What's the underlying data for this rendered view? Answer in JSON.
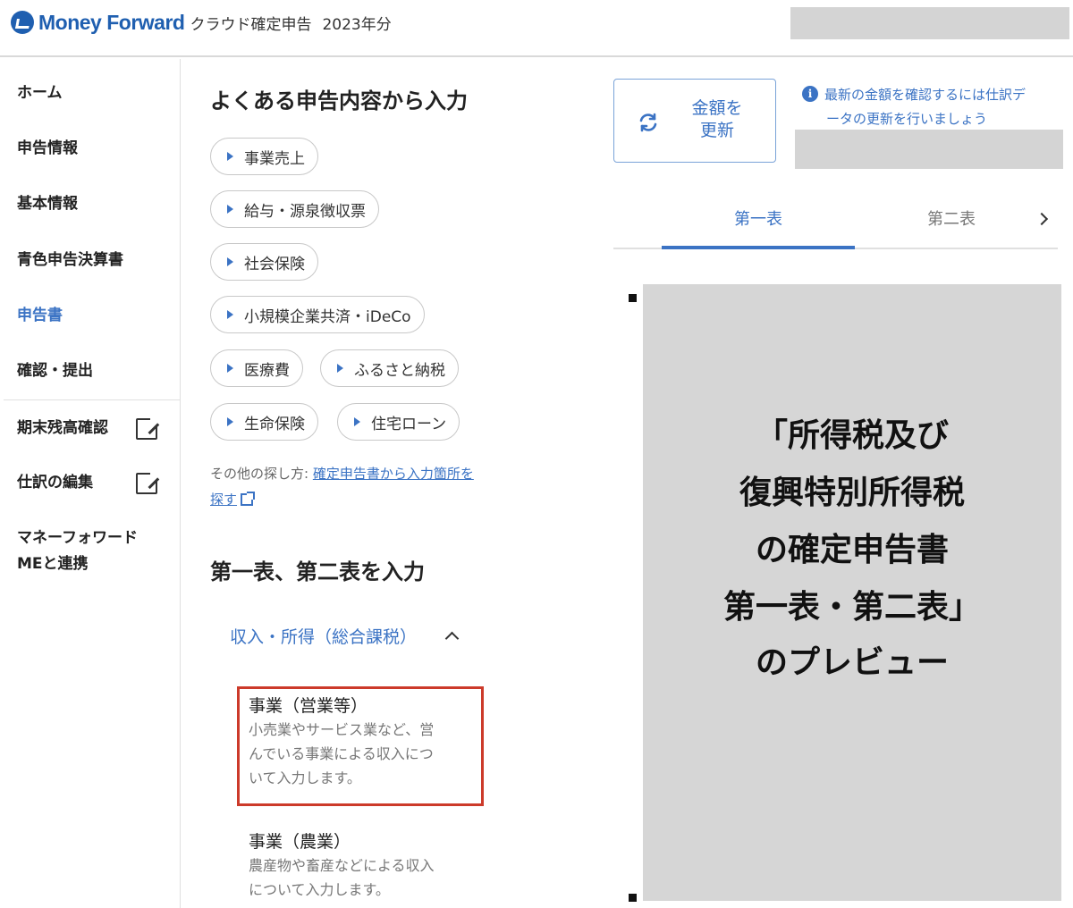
{
  "header": {
    "brand": "Money Forward",
    "product": "クラウド確定申告",
    "year": "2023年分"
  },
  "sidebar": {
    "items": [
      {
        "label": "ホーム"
      },
      {
        "label": "申告情報"
      },
      {
        "label": "基本情報"
      },
      {
        "label": "青色申告決算書"
      },
      {
        "label": "申告書"
      },
      {
        "label": "確認・提出"
      },
      {
        "label": "期末残高確認"
      },
      {
        "label": "仕訳の編集"
      },
      {
        "label_line1": "マネーフォワード",
        "label_line2": "MEと連携"
      }
    ]
  },
  "common_input": {
    "title": "よくある申告内容から入力",
    "chips": [
      "事業売上",
      "給与・源泉徴収票",
      "社会保険",
      "小規模企業共済・iDeCo",
      "医療費",
      "ふるさと納税",
      "生命保険",
      "住宅ローン"
    ],
    "other_prefix": "その他の探し方: ",
    "other_link_1": "確定申告書から入力箇所を",
    "other_link_2": "探す"
  },
  "forms_input": {
    "title": "第一表、第二表を入力",
    "accordion_label": "収入・所得（総合課税）",
    "entries": [
      {
        "title": "事業（営業等）",
        "desc_1": "小売業やサービス業など、営",
        "desc_2": "んでいる事業による収入につ",
        "desc_3": "いて入力します。"
      },
      {
        "title": "事業（農業）",
        "desc_1": "農産物や畜産などによる収入",
        "desc_2": "について入力します。"
      }
    ]
  },
  "refresh": {
    "label_1": "金額を",
    "label_2": "更新",
    "info_1": "最新の金額を確認するには仕訳デ",
    "info_2": "ータの更新を行いましょう"
  },
  "tabs": [
    "第一表",
    "第二表"
  ],
  "preview": {
    "lines": [
      "「所得税及び",
      "復興特別所得税",
      "の確定申告書",
      "第一表・第二表」",
      "のプレビュー"
    ]
  },
  "colors": {
    "brand": "#1f5fb0",
    "accent": "#3b73c4",
    "highlight": "#cc3a2a",
    "redaction": "#d4d4d4"
  }
}
